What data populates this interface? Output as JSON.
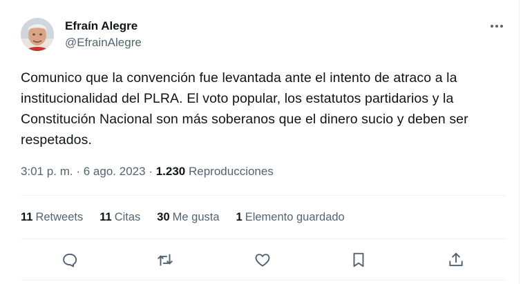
{
  "author": {
    "display_name": "Efraín Alegre",
    "handle": "@EfrainAlegre",
    "avatar_icon": "user-photo"
  },
  "tweet": {
    "text": "Comunico que la convención fue levantada ante el intento de atraco a la institucionalidad del PLRA. El voto popular, los estatutos partidarios y la Constitución Nacional son más soberanos que el dinero sucio y deben ser respetados."
  },
  "meta": {
    "time": "3:01 p. m.",
    "separator": "·",
    "date": "6 ago. 2023",
    "views_count": "1.230",
    "views_label": "Reproducciones"
  },
  "stats": {
    "retweets_count": "11",
    "retweets_label": "Retweets",
    "quotes_count": "11",
    "quotes_label": "Citas",
    "likes_count": "30",
    "likes_label": "Me gusta",
    "bookmarks_count": "1",
    "bookmarks_label": "Elemento guardado"
  },
  "actions": {
    "icons": [
      "reply-icon",
      "retweet-icon",
      "like-icon",
      "bookmark-icon",
      "share-icon"
    ]
  },
  "colors": {
    "text_primary": "#0f1419",
    "text_secondary": "#536471",
    "divider": "#eff3f4"
  }
}
